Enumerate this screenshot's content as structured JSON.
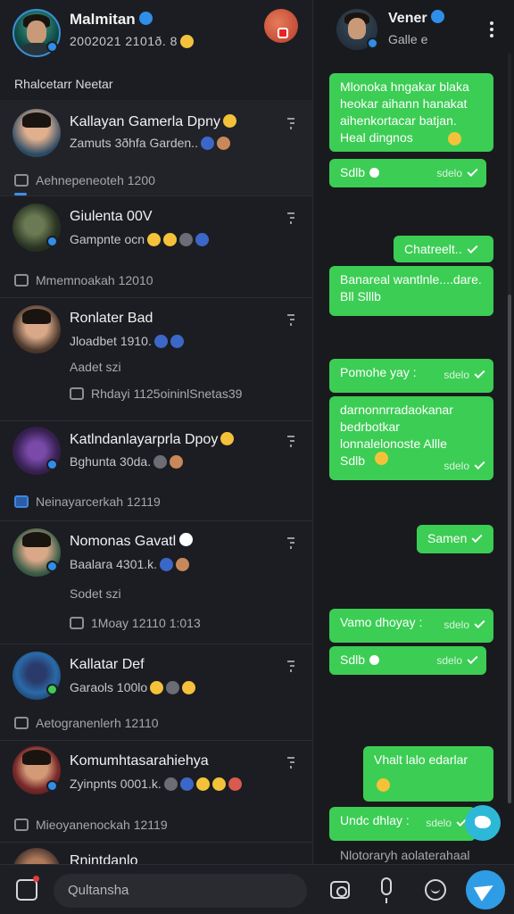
{
  "profile": {
    "name": "Malmitan",
    "subtitle": "2002021 2101ð. 8"
  },
  "section_title": "Rhalcetarr Neetar",
  "chats": [
    {
      "name": "Kallayan Gamerla Dpny",
      "preview": "Zamuts 3ðhfa Garden..",
      "meta": "Aehnepeneoteh 1200"
    },
    {
      "name": "Giulenta 00V",
      "preview": "Gampnte ocn",
      "meta": "Mmemnoakah 12010"
    },
    {
      "name": "Ronlater Bad",
      "preview": "Jloadbet 1910.",
      "extra1": "Aadet szi",
      "extra2": "Rhdayi 1125oininlSnetas39"
    },
    {
      "name": "Katlndanlayarprla Dpoy",
      "preview": "Bghunta 30da.",
      "meta": "Neinayarcerkah 12119"
    },
    {
      "name": "Nomonas Gavatl",
      "preview": "Baalara 4301.k.",
      "extra1": "Sodet szi",
      "extra2": "1Moay 12110 1:013"
    },
    {
      "name": "Kallatar Def",
      "preview": "Garaols 100lo",
      "meta": "Aetogranenlerh 12110"
    },
    {
      "name": "Komumhtasarahiehya",
      "preview": "Zyinpnts 0001.k.",
      "meta": "Mieoyanenockah 12119"
    },
    {
      "name": "Rnintdanlo",
      "preview": "",
      "meta": ""
    }
  ],
  "conversation": {
    "name": "Vener",
    "subtitle": "Galle e",
    "messages": [
      {
        "text": "Mlonoka hngakar blaka heokar aihann hanakat aihenkortacar batjan. Heal dingnos",
        "meta": ""
      },
      {
        "text": "Sdlb",
        "meta": "sdelo"
      },
      {
        "text": "Chatreelt..",
        "meta": ""
      },
      {
        "text": "Banareal wantlnle....dare. Bll Slllb",
        "meta": ""
      },
      {
        "text": "Pomohe yay :",
        "meta": "sdelo"
      },
      {
        "text": "darnonnrradaokanar bedrbotkar lonnalelonoste Allle Sdlb",
        "meta": "sdelo"
      },
      {
        "text": "Samen",
        "meta": ""
      },
      {
        "text": "Vamo dhoyay :",
        "meta": "sdelo"
      },
      {
        "text": "Sdlb",
        "meta": "sdelo"
      },
      {
        "text": "Vhalt lalo edarlar",
        "meta": ""
      },
      {
        "text": "Undc dhlay :",
        "meta": "sdelo"
      }
    ],
    "footnote": "Nlotoraryh aolaterahaal"
  },
  "search": {
    "placeholder": "Qultansha"
  },
  "colors": {
    "bubble": "#3ccd54",
    "accent": "#2f9de6",
    "background": "#17181c"
  },
  "icons": [
    "compose-icon",
    "camera-icon",
    "mic-icon",
    "sticker-icon",
    "send-icon",
    "more-icon",
    "verified-icon"
  ]
}
